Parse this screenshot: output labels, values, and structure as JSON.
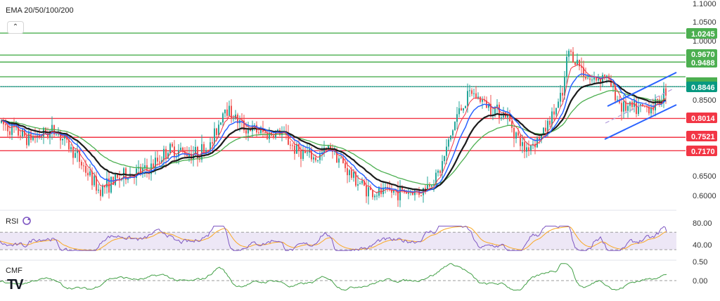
{
  "main": {
    "indicator_title": "EMA 20/50/100/200",
    "collapse_icon": "chevron-up-icon",
    "axis_ticks": [
      "1.1000",
      "1.0500",
      "1.0000",
      "0.8500",
      "0.6500",
      "0.6000"
    ],
    "levels": [
      {
        "label": "1.0245",
        "value": 1.0245,
        "color": "#4caf50"
      },
      {
        "label": "0.9670",
        "value": 0.967,
        "color": "#4caf50"
      },
      {
        "label": "0.9488",
        "value": 0.9488,
        "color": "#4caf50"
      },
      {
        "label": "0.8846",
        "value": 0.8846,
        "color": "#089981"
      },
      {
        "label": "0.8014",
        "value": 0.8014,
        "color": "#f23645"
      },
      {
        "label": "0.7521",
        "value": 0.7521,
        "color": "#f23645"
      },
      {
        "label": "0.7170",
        "value": 0.717,
        "color": "#f23645"
      }
    ],
    "hidden_level_value": 0.9104,
    "colors": {
      "up": "#26a69a",
      "down": "#ef5350",
      "ema20": "#f23645",
      "ema50": "#2962ff",
      "ema100": "#1b1b1b",
      "ema200": "#4caf50",
      "channel": "#2962ff"
    }
  },
  "rsi": {
    "title": "RSI",
    "icon": "refresh-icon",
    "ticks": [
      "80.00",
      "40.00"
    ],
    "upper": 70,
    "lower": 30,
    "colors": {
      "line": "#7e57c2",
      "ma": "#f9a825",
      "band": "#ede7f6"
    }
  },
  "cmf": {
    "title": "CMF",
    "ticks": [
      "0.50",
      "0.00"
    ],
    "colors": {
      "line": "#43a047"
    }
  },
  "logo": {
    "text": "TV"
  }
}
